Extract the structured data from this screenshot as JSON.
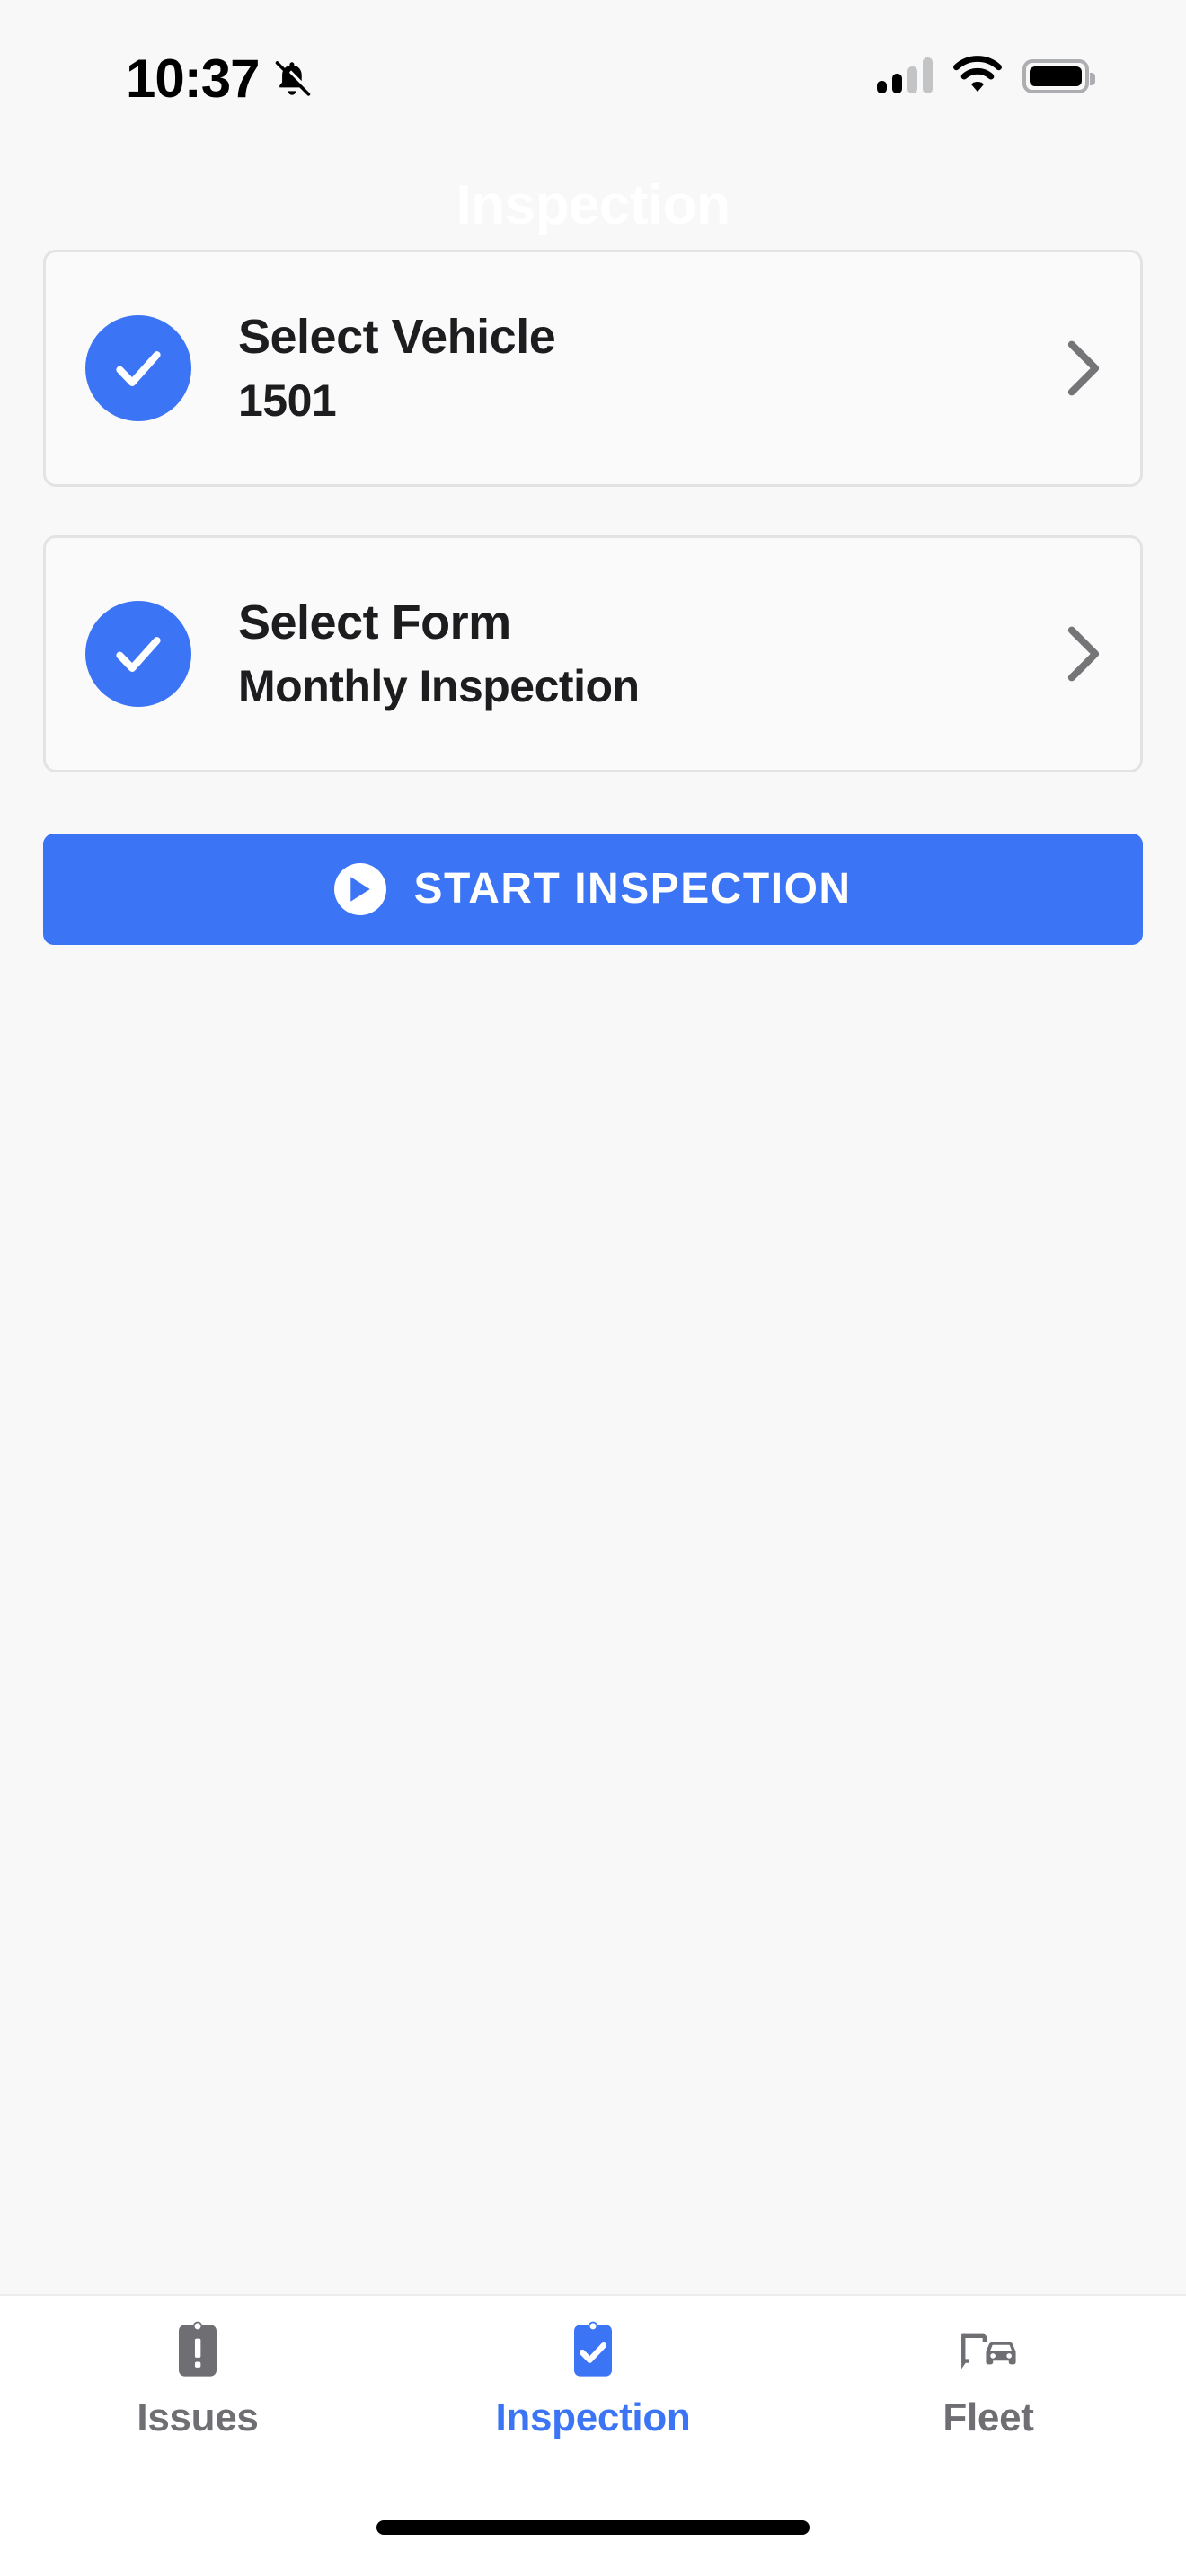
{
  "status_bar": {
    "time": "10:37",
    "notifications_icon": "bell-slash-icon",
    "cellular_icon": "cellular-signal-icon",
    "cellular_bars_filled": 2,
    "cellular_bars_total": 4,
    "wifi_icon": "wifi-icon",
    "battery_icon": "battery-icon",
    "battery_level_percent": 88
  },
  "header": {
    "title": "Inspection",
    "title_color": "#ffffff"
  },
  "cards": [
    {
      "status_icon": "check-circle-icon",
      "title": "Select Vehicle",
      "value": "1501",
      "chevron_icon": "chevron-right-icon"
    },
    {
      "status_icon": "check-circle-icon",
      "title": "Select Form",
      "value": "Monthly Inspection",
      "chevron_icon": "chevron-right-icon"
    }
  ],
  "primary_action": {
    "label": "START INSPECTION",
    "icon": "play-circle-icon",
    "color": "#3b74f5"
  },
  "tabs": [
    {
      "label": "Issues",
      "icon": "clipboard-alert-icon",
      "active": false
    },
    {
      "label": "Inspection",
      "icon": "clipboard-check-icon",
      "active": true
    },
    {
      "label": "Fleet",
      "icon": "truck-car-icon",
      "active": false
    }
  ],
  "colors": {
    "accent": "#3b74f5",
    "page_background": "#f8f8f9",
    "card_background": "#fafafa",
    "card_border": "#e3e3e4",
    "text_primary": "#1d1d1f",
    "text_muted": "#6e6e73",
    "tabbar_background": "#ffffff"
  },
  "home_indicator": "home-indicator-bar"
}
